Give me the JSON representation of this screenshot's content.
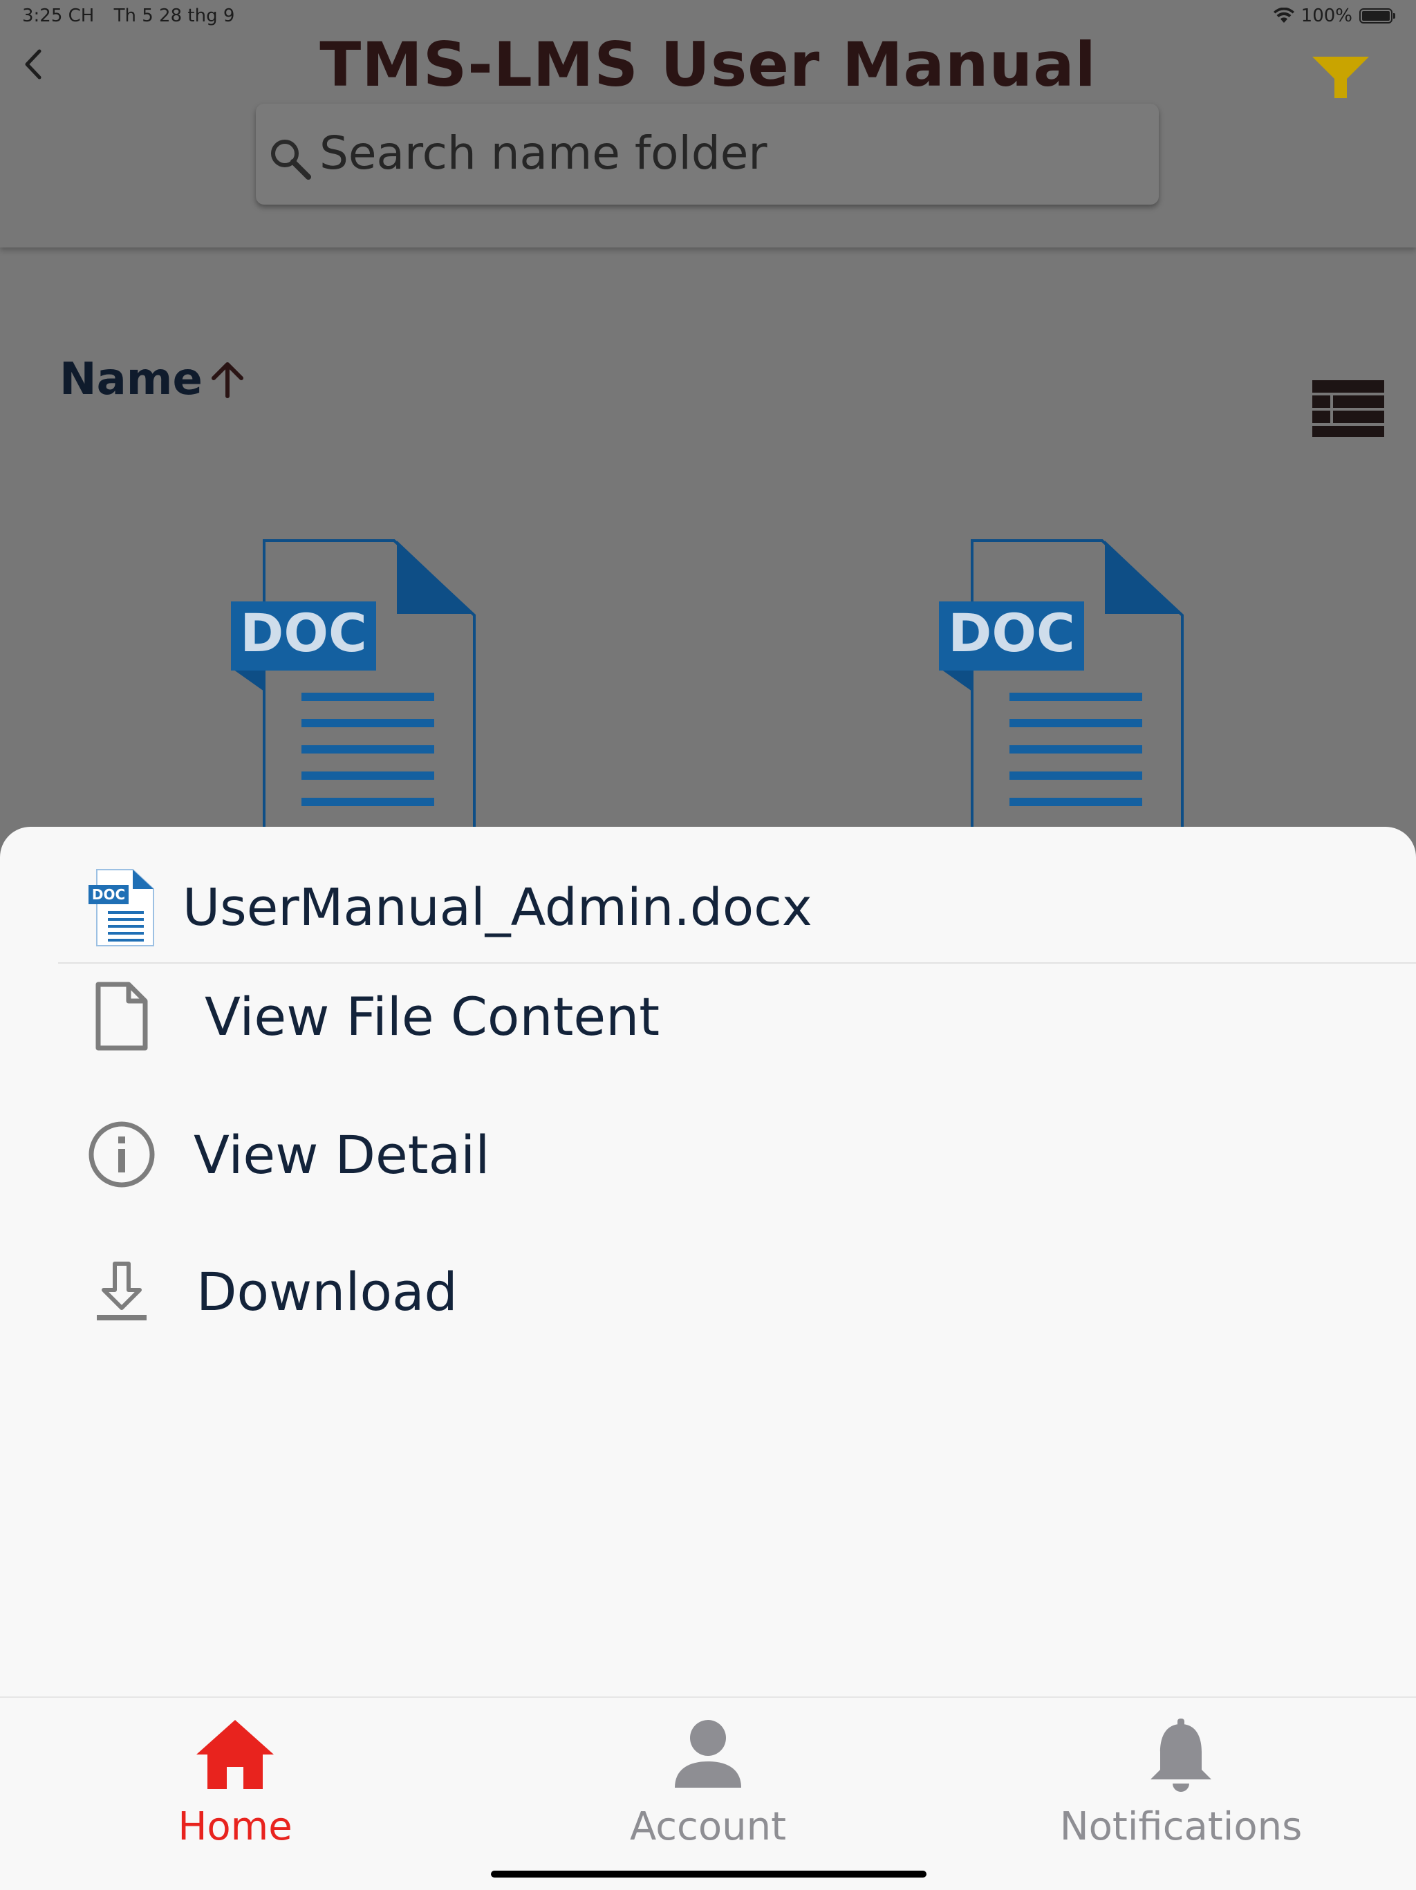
{
  "status_bar": {
    "time": "3:25 CH",
    "date": "Th 5 28 thg 9",
    "battery": "100%"
  },
  "header": {
    "title": "TMS-LMS User Manual",
    "back_icon": "chevron-left-icon",
    "filter_icon": "filter-icon",
    "filter_color": "#C9A400"
  },
  "search": {
    "placeholder": "Search name folder",
    "value": ""
  },
  "sort": {
    "label": "Name",
    "direction_icon": "arrow-up-icon",
    "view_icon": "list-view-icon"
  },
  "documents": [
    {
      "badge": "DOC"
    },
    {
      "badge": "DOC"
    }
  ],
  "sheet": {
    "file_name": "UserManual_Admin.docx",
    "file_badge": "DOC",
    "actions": [
      {
        "label": "View File Content",
        "icon": "file-icon"
      },
      {
        "label": "View Detail",
        "icon": "info-icon"
      },
      {
        "label": "Download",
        "icon": "download-icon"
      }
    ]
  },
  "tabs": [
    {
      "label": "Home",
      "icon": "home-icon",
      "active": true
    },
    {
      "label": "Account",
      "icon": "person-icon",
      "active": false
    },
    {
      "label": "Notifications",
      "icon": "bell-icon",
      "active": false
    }
  ],
  "colors": {
    "active_tab": "#E8231E",
    "inactive_tab": "#8E8E93",
    "doc_blue": "#1F6FB5",
    "doc_dark_blue": "#0E4E86"
  }
}
